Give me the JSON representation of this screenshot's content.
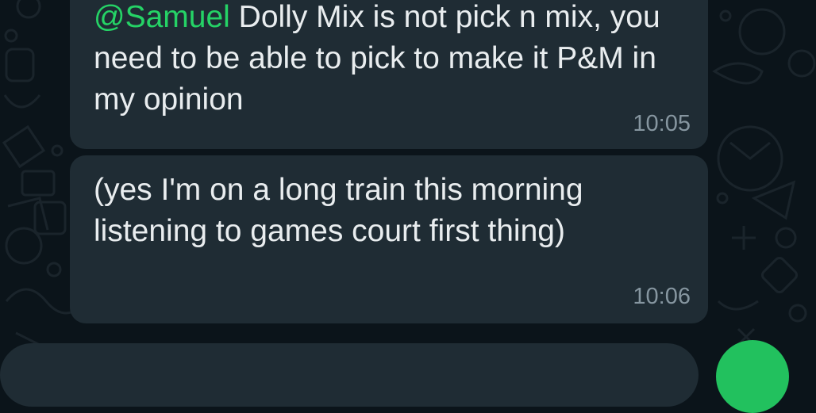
{
  "messages": [
    {
      "mention": "@Samuel",
      "text": " Dolly Mix is not pick n mix, you need to be able to pick to make it P&M in my opinion",
      "time": "10:05"
    },
    {
      "text": "(yes I'm on a long train this morning listening to games court first thing)",
      "time": "10:06"
    }
  ],
  "colors": {
    "background": "#0b141a",
    "bubble": "#1f2c34",
    "mention": "#25d366",
    "text": "#e9edef",
    "timestamp": "#8696a0",
    "send_button": "#22c15e"
  },
  "icons": [
    "chat-wallpaper-doodles",
    "mic-icon"
  ]
}
